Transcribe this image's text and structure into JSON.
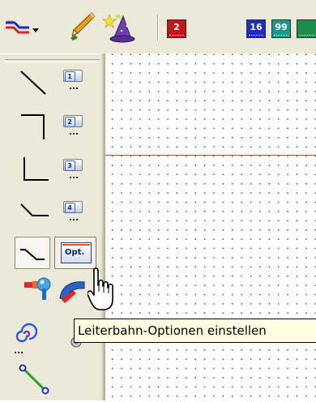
{
  "toolbar": {
    "route_tool_icon": "route-dropdown-icon",
    "pencil_icon": "pencil-icon",
    "wizard_icon": "wizard-hat-icon",
    "counters": [
      {
        "label": "2",
        "color": "#c41616"
      },
      {
        "label": "16",
        "color": "#1c2ec2"
      },
      {
        "label": "99",
        "color": "#169a8c"
      }
    ]
  },
  "palette": {
    "items": [
      {
        "name": "route-diagonal",
        "badge": "1"
      },
      {
        "name": "route-corner",
        "badge": "2"
      },
      {
        "name": "route-l-shape",
        "badge": "3"
      },
      {
        "name": "route-chamfer",
        "badge": "4"
      }
    ],
    "options_button_label": "Opt.",
    "tools": [
      "line-tool-icon",
      "pin-connect-icon",
      "bend-icon",
      "spiral-icon",
      "via-icon",
      "diagonal-wire-icon"
    ]
  },
  "tooltip": {
    "text": "Leiterbahn-Optionen einstellen"
  },
  "colors": {
    "reference_line": "#ff2a2a",
    "tooltip_bg": "#ffffe1",
    "toolbar_bg": "#ece9d8"
  }
}
